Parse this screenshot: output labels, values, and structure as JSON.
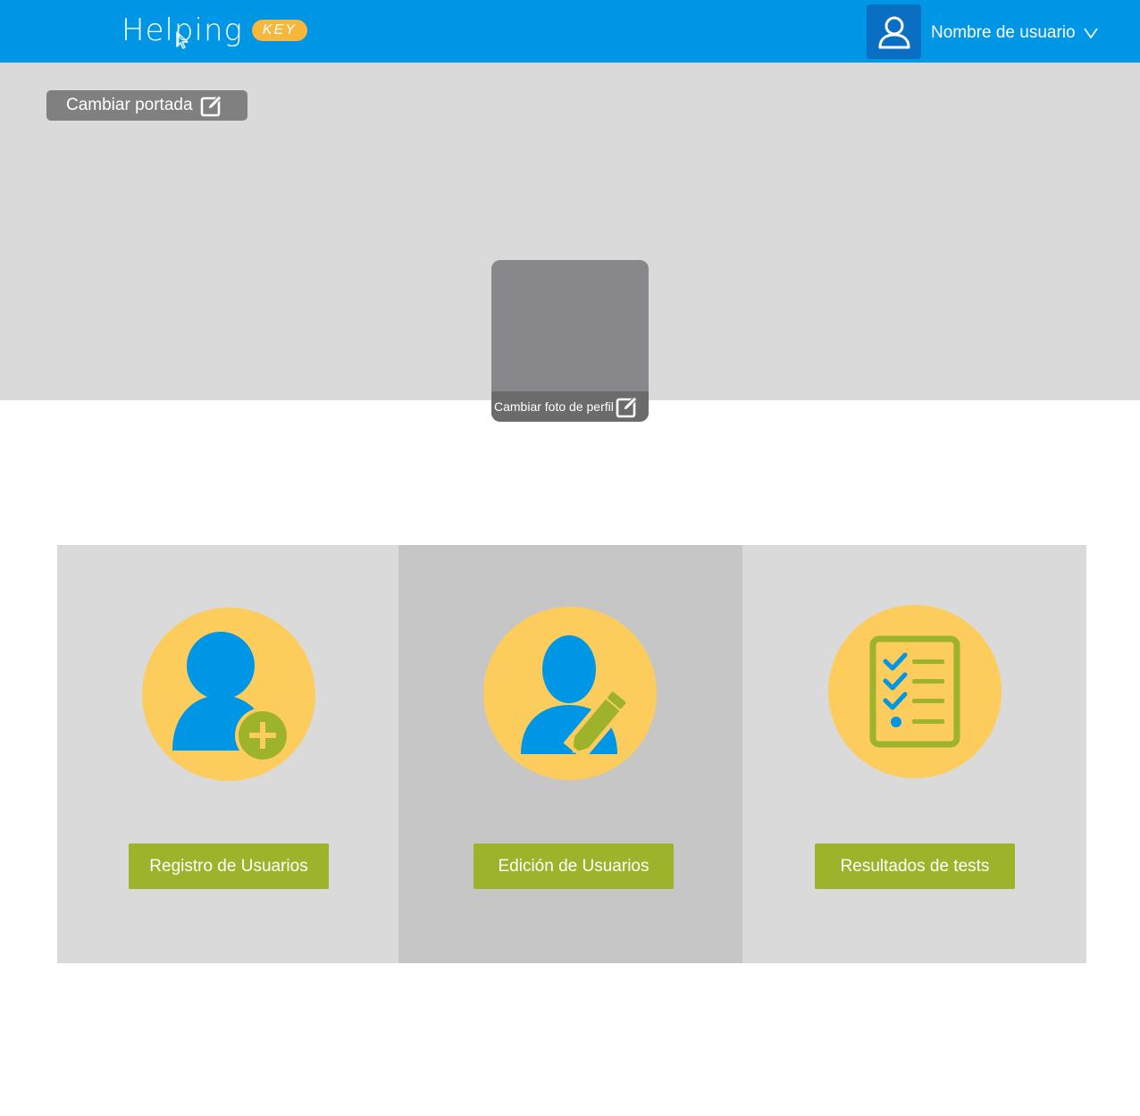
{
  "header": {
    "logo_text": "Helping",
    "logo_badge": "KEY",
    "username": "Nombre de usuario",
    "user_icon": "user-icon",
    "chevron_icon": "chevron-down-icon"
  },
  "cover": {
    "change_cover_label": "Cambiar portada",
    "edit_icon": "edit-icon"
  },
  "profile": {
    "change_photo_label": "Cambiar foto de perfil",
    "edit_icon": "edit-icon"
  },
  "cards": [
    {
      "label": "Registro de Usuarios",
      "icon": "add-user-icon"
    },
    {
      "label": "Edición de Usuarios",
      "icon": "edit-user-icon"
    },
    {
      "label": "Resultados de tests",
      "icon": "checklist-icon"
    }
  ],
  "colors": {
    "header_blue": "#0096e6",
    "avatar_box": "#0a6fc2",
    "cover_gray": "#dadada",
    "card_active": "#c6c6c6",
    "circle_yellow": "#fccd5c",
    "button_green": "#9db32b",
    "icon_blue": "#0096e6",
    "badge_orange": "#f6b73c"
  }
}
